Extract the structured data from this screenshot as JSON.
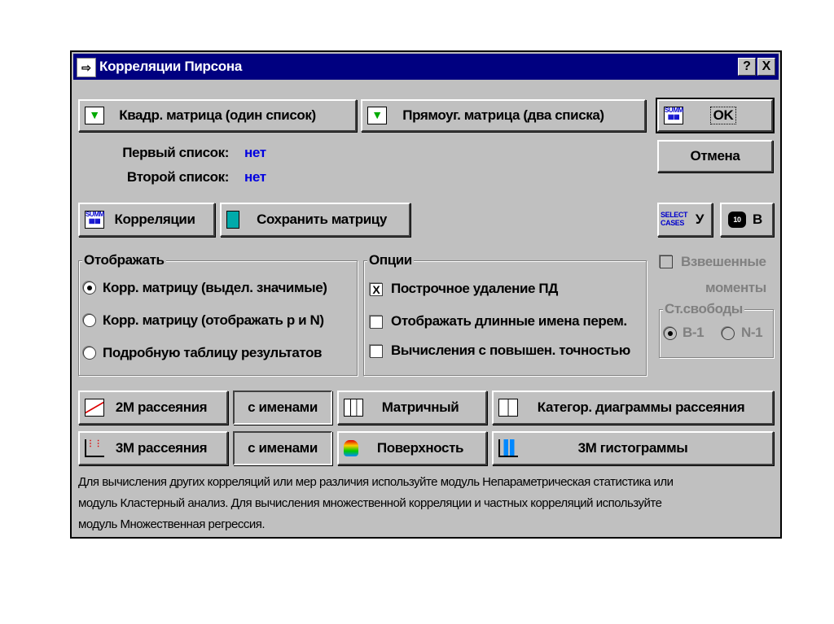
{
  "window": {
    "title": "Корреляции Пирсона",
    "help": "?",
    "close": "X"
  },
  "buttons": {
    "square": "Квадр. матрица (один список)",
    "rect": "Прямоуг. матрица (два списка)",
    "ok": "OK",
    "cancel": "Отмена",
    "corr": "Корреляции",
    "save": "Сохранить матрицу",
    "select": "У",
    "select_icon_text": "SELECT CASES",
    "weights": "В",
    "weights_icon_text": "10"
  },
  "lists": {
    "first_label": "Первый список:",
    "first_value": "нет",
    "second_label": "Второй список:",
    "second_value": "нет"
  },
  "display": {
    "title": "Отображать",
    "options": [
      {
        "label": "Корр. матрицу (выдел. значимые)",
        "selected": true
      },
      {
        "label": "Корр. матрицу (отображать р и N)",
        "selected": false
      },
      {
        "label": "Подробную таблицу результатов",
        "selected": false
      }
    ]
  },
  "options": {
    "title": "Опции",
    "items": [
      {
        "label": "Построчное удаление ПД",
        "checked": true,
        "mark": "X"
      },
      {
        "label": "Отображать длинные имена перем.",
        "checked": false
      },
      {
        "label": "Вычисления с повышен. точностью",
        "checked": false
      }
    ]
  },
  "weighted": {
    "label1": "Взвешенные",
    "label2": "моменты",
    "df_title": "Ст.свободы",
    "df_options": [
      {
        "label": "B-1",
        "selected": true
      },
      {
        "label": "N-1",
        "selected": false
      }
    ]
  },
  "plots": {
    "scatter2d": "2М рассеяния",
    "names1": "с именами",
    "matrix": "Матричный",
    "categ": "Категор. диаграммы рассеяния",
    "scatter3d": "3М рассеяния",
    "names2": "с именами",
    "surface": "Поверхность",
    "hist3d": "3М гистограммы"
  },
  "note": [
    "Для вычисления других корреляций или мер различия используйте модуль Непараметрическая статистика или",
    "модуль Кластерный анализ. Для вычисления множественной корреляции и частных корреляций используйте",
    "модуль Множественная регрессия."
  ]
}
